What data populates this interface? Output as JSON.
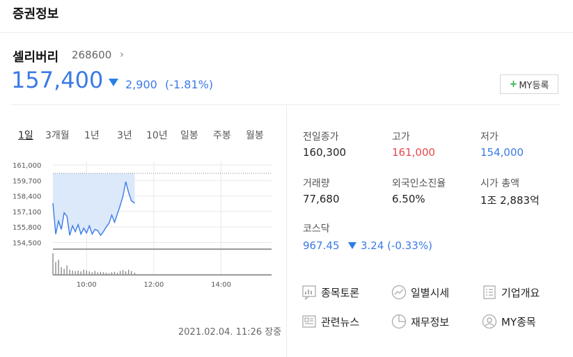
{
  "header": {
    "title": "증권정보"
  },
  "stock": {
    "name": "셀리버리",
    "code": "268600",
    "chevron": "›",
    "price": "157,400",
    "change": "2,900",
    "change_pct": "(-1.81%)",
    "direction": "down"
  },
  "my_button": {
    "plus": "+",
    "label": "MY등록"
  },
  "period_tabs": [
    {
      "label": "1일",
      "active": true
    },
    {
      "label": "3개월",
      "active": false
    },
    {
      "label": "1년",
      "active": false
    },
    {
      "label": "3년",
      "active": false
    },
    {
      "label": "10년",
      "active": false
    },
    {
      "label": "일봉",
      "active": false
    },
    {
      "label": "주봉",
      "active": false
    },
    {
      "label": "월봉",
      "active": false
    }
  ],
  "chart_data": {
    "type": "line",
    "y_ticks": [
      "161,000",
      "159,700",
      "158,400",
      "157,100",
      "155,800",
      "154,500"
    ],
    "x_ticks": [
      "10:00",
      "12:00",
      "14:00"
    ],
    "ylim": [
      154000,
      161300
    ],
    "prev_close": 160300,
    "x_range": [
      "09:00",
      "15:30"
    ],
    "series": [
      {
        "x": [
          "09:00",
          "09:05",
          "09:10",
          "09:15",
          "09:20",
          "09:25",
          "09:30",
          "09:35",
          "09:40",
          "09:45",
          "09:50",
          "09:55",
          "10:00",
          "10:05",
          "10:10",
          "10:15",
          "10:20",
          "10:25",
          "10:30",
          "10:35",
          "10:40",
          "10:45",
          "10:50",
          "10:55",
          "11:00",
          "11:05",
          "11:10",
          "11:15",
          "11:20",
          "11:26"
        ],
        "y": [
          157800,
          155200,
          156300,
          155600,
          157000,
          156700,
          155100,
          155900,
          155400,
          156000,
          155200,
          155700,
          155300,
          155900,
          155200,
          155600,
          155500,
          155100,
          155400,
          155800,
          156100,
          156800,
          156200,
          156900,
          157600,
          158400,
          159600,
          158700,
          158000,
          157800
        ]
      }
    ],
    "volume": [
      50,
      30,
      35,
      18,
      14,
      22,
      12,
      10,
      9,
      10,
      8,
      12,
      10,
      8,
      6,
      9,
      6,
      7,
      6,
      5,
      4,
      6,
      7,
      5,
      9,
      11,
      8,
      12,
      9,
      5
    ],
    "title": "",
    "xlabel": "",
    "ylabel": ""
  },
  "timestamp": "2021.02.04. 11:26 장중",
  "stats": [
    {
      "label": "전일종가",
      "value": "160,300",
      "color": "default"
    },
    {
      "label": "고가",
      "value": "161,000",
      "color": "red"
    },
    {
      "label": "저가",
      "value": "154,000",
      "color": "blue"
    },
    {
      "label": "거래량",
      "value": "77,680",
      "color": "default"
    },
    {
      "label": "외국인소진율",
      "value": "6.50%",
      "color": "default"
    },
    {
      "label": "시가 총액",
      "value": "1조 2,883억",
      "color": "default"
    }
  ],
  "kosdaq": {
    "label": "코스닥",
    "value": "967.45",
    "change": "3.24 (-0.33%)",
    "direction": "down"
  },
  "links": [
    {
      "label": "종목토론",
      "icon": "discussion-icon"
    },
    {
      "label": "일별시세",
      "icon": "trend-icon"
    },
    {
      "label": "기업개요",
      "icon": "list-icon"
    },
    {
      "label": "관련뉴스",
      "icon": "news-icon"
    },
    {
      "label": "재무정보",
      "icon": "pie-icon"
    },
    {
      "label": "MY종목",
      "icon": "person-icon"
    }
  ],
  "colors": {
    "accent_blue": "#3b7ae6",
    "red": "#e5484d",
    "green_plus": "#2dae4a",
    "chart_fill": "#dce9fb"
  }
}
